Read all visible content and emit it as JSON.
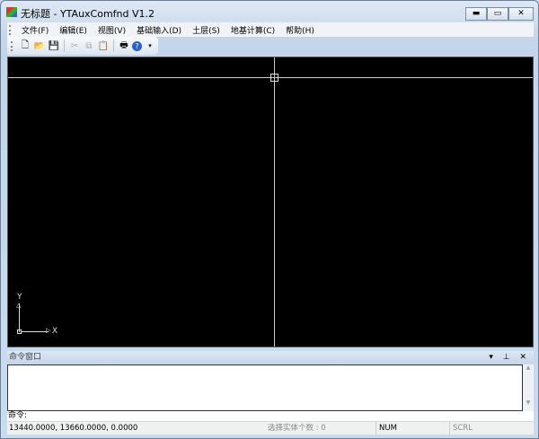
{
  "window": {
    "title": "无标题 - YTAuxComfnd V1.2",
    "controls": {
      "minimize": "▬",
      "maximize": "▭",
      "close": "✕"
    }
  },
  "menu": [
    "文件(F)",
    "编辑(E)",
    "视图(V)",
    "基础输入(D)",
    "土层(S)",
    "地基计算(C)",
    "帮助(H)"
  ],
  "toolbar": [
    {
      "name": "new-icon",
      "glyph": "🗋"
    },
    {
      "name": "open-icon",
      "glyph": "📂"
    },
    {
      "name": "save-icon",
      "glyph": "💾"
    },
    {
      "name": "cut-icon",
      "glyph": "✂"
    },
    {
      "name": "copy-icon",
      "glyph": "⧉"
    },
    {
      "name": "paste-icon",
      "glyph": "📋"
    },
    {
      "name": "print-icon",
      "glyph": "🖶"
    },
    {
      "name": "help-icon",
      "glyph": "?"
    }
  ],
  "canvas": {
    "axis_x": "X",
    "axis_y": "Y"
  },
  "command_window": {
    "title": "命令窗口",
    "buttons": "▾ ⊥ ✕",
    "prompt": "命令:"
  },
  "status": {
    "coords": "13440.0000, 13660.0000, 0.0000",
    "selection": "选择实体个数 : 0",
    "num": "NUM",
    "scrl": "SCRL"
  }
}
